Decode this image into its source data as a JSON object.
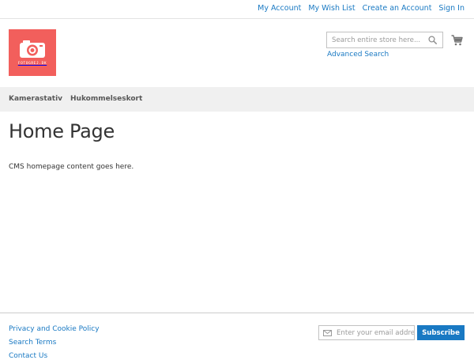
{
  "top_links": {
    "my_account": "My Account",
    "my_wish_list": "My Wish List",
    "create_account": "Create an Account",
    "sign_in": "Sign In"
  },
  "logo": {
    "text": "FOTOGREJ.DK"
  },
  "search": {
    "placeholder": "Search entire store here...",
    "value": "",
    "advanced_label": "Advanced Search"
  },
  "nav": {
    "items": [
      {
        "label": "Kamerastativ"
      },
      {
        "label": "Hukommelseskort"
      }
    ]
  },
  "main": {
    "title": "Home Page",
    "content": "CMS homepage content goes here."
  },
  "footer": {
    "links": [
      {
        "label": "Privacy and Cookie Policy"
      },
      {
        "label": "Search Terms"
      },
      {
        "label": "Contact Us"
      }
    ],
    "newsletter": {
      "placeholder": "Enter your email address",
      "value": "",
      "button_label": "Subscribe"
    }
  },
  "colors": {
    "link": "#1979c3",
    "logo_bg": "#f25f5c",
    "nav_bg": "#f0f0f0",
    "button_bg": "#1979c3"
  },
  "icons": {
    "search": "search-icon",
    "cart": "cart-icon",
    "envelope": "envelope-icon",
    "camera": "camera-icon"
  }
}
